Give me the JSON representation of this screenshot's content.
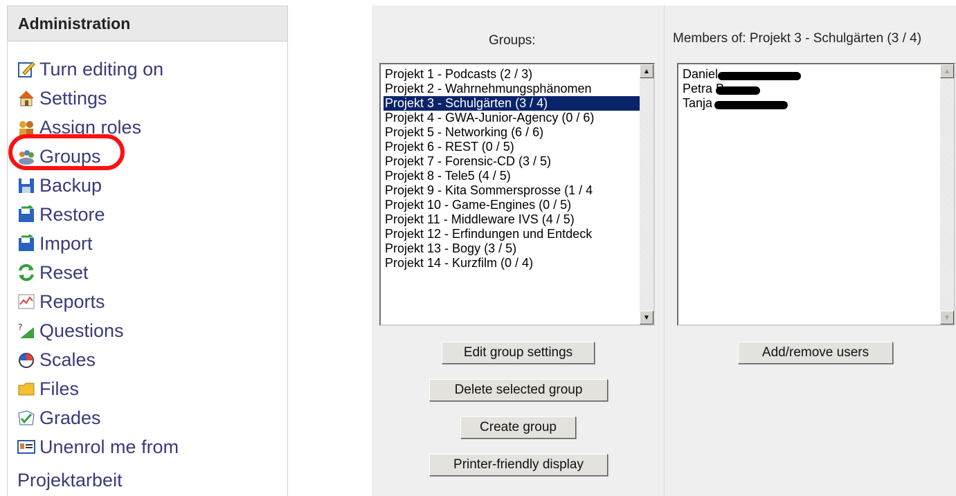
{
  "admin": {
    "title": "Administration",
    "items": [
      {
        "label": "Turn editing on",
        "icon": "edit-icon"
      },
      {
        "label": "Settings",
        "icon": "settings-icon"
      },
      {
        "label": "Assign roles",
        "icon": "roles-icon"
      },
      {
        "label": "Groups",
        "icon": "groups-icon"
      },
      {
        "label": "Backup",
        "icon": "backup-icon"
      },
      {
        "label": "Restore",
        "icon": "restore-icon"
      },
      {
        "label": "Import",
        "icon": "import-icon"
      },
      {
        "label": "Reset",
        "icon": "reset-icon"
      },
      {
        "label": "Reports",
        "icon": "reports-icon"
      },
      {
        "label": "Questions",
        "icon": "questions-icon"
      },
      {
        "label": "Scales",
        "icon": "scales-icon"
      },
      {
        "label": "Files",
        "icon": "folder-icon"
      },
      {
        "label": "Grades",
        "icon": "grades-icon"
      },
      {
        "label": "Unenrol me from",
        "icon": "unenrol-icon"
      }
    ],
    "tail": "Projektarbeit"
  },
  "groups": {
    "title": "Groups:",
    "items": [
      "Projekt 1 - Podcasts (2 / 3)",
      "Projekt 2 - Wahrnehmungsphänomen",
      "Projekt 3 - Schulgärten (3 / 4)",
      "Projekt 4 - GWA-Junior-Agency (0 / 6)",
      "Projekt 5 - Networking (6 / 6)",
      "Projekt 6 - REST (0 / 5)",
      "Projekt 7 - Forensic-CD (3 / 5)",
      "Projekt 8 - Tele5 (4 / 5)",
      "Projekt 9 - Kita Sommersprosse (1 / 4",
      "Projekt 10 - Game-Engines (0 / 5)",
      "Projekt 11 - Middleware IVS (4 / 5)",
      "Projekt 12 - Erfindungen und Entdeck",
      "Projekt 13 - Bogy (3 / 5)",
      "Projekt 14 - Kurzfilm (0 / 4)"
    ],
    "selected_index": 2,
    "buttons": {
      "edit": "Edit group settings",
      "delete": "Delete selected group",
      "create": "Create group",
      "print": "Printer-friendly display"
    }
  },
  "members": {
    "title": "Members of: Projekt 3 - Schulgärten (3 / 4)",
    "items": [
      "Daniel",
      "Petra B",
      "Tanja"
    ],
    "button": "Add/remove users"
  },
  "colors": {
    "selection": "#0a246a",
    "highlight_ring": "#ff1010",
    "link": "#3a3a7a"
  }
}
